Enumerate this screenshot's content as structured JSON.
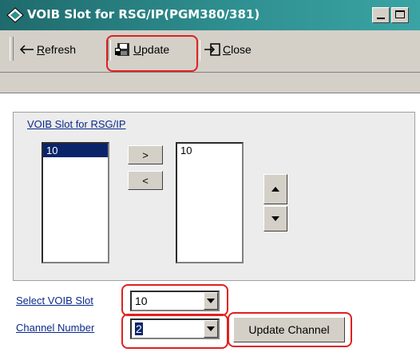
{
  "window": {
    "title": "VOIB Slot for RSG/IP(PGM380/381)"
  },
  "toolbar": {
    "refresh_label": "Refresh",
    "update_label": "Update",
    "close_label": "Close"
  },
  "group": {
    "title": "VOIB Slot for RSG/IP",
    "available_items": [
      "10"
    ],
    "selected_items": [
      "10"
    ],
    "move_right_label": ">",
    "move_left_label": "<"
  },
  "form": {
    "slot_label": "Select VOIB Slot",
    "slot_value": "10",
    "channel_label": "Channel Number",
    "channel_value": "2",
    "update_channel_label": "Update Channel"
  },
  "colors": {
    "annotation_ring": "#e02020",
    "selection": "#0a246a",
    "link": "#0b2a8a"
  }
}
